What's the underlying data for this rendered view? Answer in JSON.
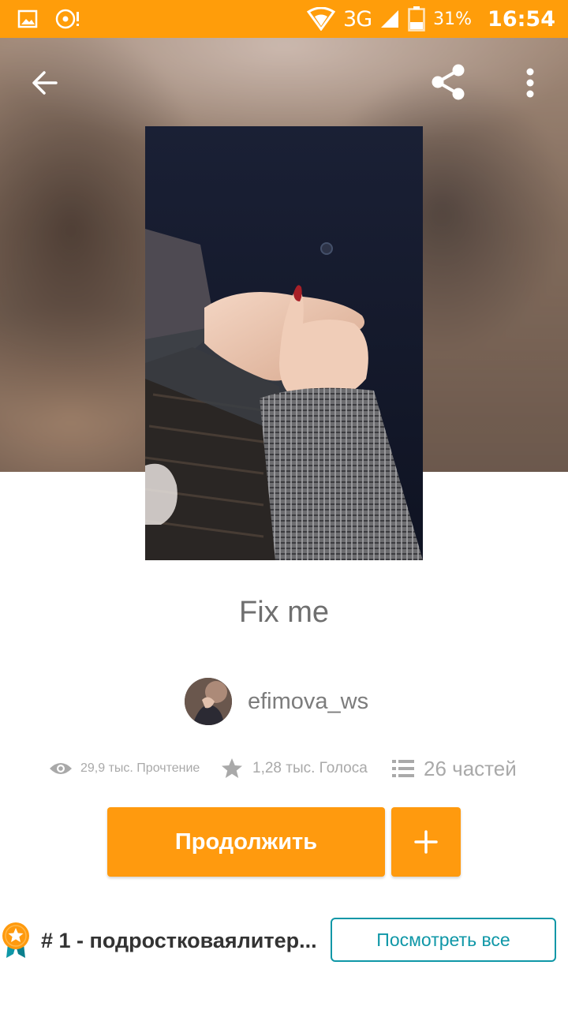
{
  "status_bar": {
    "network": "3G",
    "battery": "31%",
    "time": "16:54",
    "icons": [
      "image-icon",
      "disc-icon",
      "wifi-icon",
      "signal-icon",
      "battery-icon"
    ]
  },
  "toolbar": {
    "icons": [
      "back-arrow-icon",
      "share-icon",
      "more-vert-icon"
    ]
  },
  "story": {
    "title": "Fix me",
    "author": "efimova_ws",
    "reads": "29,9 тыс. Прочтение",
    "votes": "1,28 тыс. Голоса",
    "parts": "26 частей"
  },
  "actions": {
    "continue_label": "Продолжить",
    "add_icon": "plus-icon"
  },
  "ranking": {
    "text": "# 1 - подростковаялитер...",
    "view_all_label": "Посмотреть все",
    "badge_icon": "award-ribbon-icon"
  },
  "colors": {
    "accent": "#ff9d0a",
    "button": "#ff9a0e",
    "teal": "#0f97a7",
    "title_text": "#6f6f6f",
    "meta_text": "#a9a9a9"
  }
}
